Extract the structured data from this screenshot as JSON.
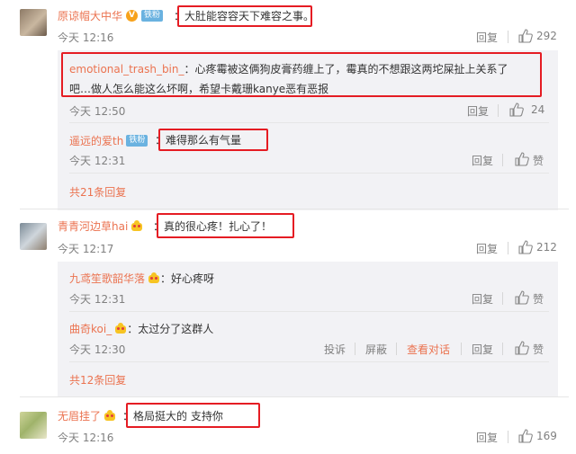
{
  "comments": [
    {
      "username": "原谅帽大中华",
      "badge": "铁粉",
      "sep": "：",
      "text": "大肚能容容天下难容之事。",
      "time": "今天 12:16",
      "reply_label": "回复",
      "likes": "292",
      "replies": [
        {
          "username": "emotional_trash_bin_",
          "sep": "：",
          "text_line1": "心疼霉被这俩狗皮膏药缠上了，霉真的不想跟这两坨屎扯上关系了",
          "text_line2": "吧…做人怎么能这么坏啊，希望卡戴珊kanye恶有恶报",
          "time": "今天 12:50",
          "reply_label": "回复",
          "likes": "24"
        },
        {
          "username": "遥远的爱th",
          "badge": "铁粉",
          "sep": "：",
          "text": "难得那么有气量",
          "time": "今天 12:31",
          "reply_label": "回复",
          "likes": "赞"
        }
      ],
      "more_replies": "共21条回复"
    },
    {
      "username": "青青河边草hai",
      "sep": "：",
      "text": "真的很心疼！扎心了！",
      "time": "今天 12:17",
      "reply_label": "回复",
      "likes": "212",
      "replies": [
        {
          "username": "九鸢笙歌韶华落",
          "sep": "：",
          "text": "好心疼呀",
          "time": "今天 12:31",
          "reply_label": "回复",
          "likes": "赞"
        },
        {
          "username": "曲奇koi_",
          "sep": "：",
          "text": "太过分了这群人",
          "time": "今天 12:30",
          "actions": [
            "投诉",
            "屏蔽",
            "查看对话"
          ],
          "reply_label": "回复",
          "likes": "赞"
        }
      ],
      "more_replies": "共12条回复"
    },
    {
      "username": "无眉挂了",
      "sep": "：",
      "text": "格局挺大的 支持你",
      "time": "今天 12:16",
      "reply_label": "回复",
      "likes": "169"
    }
  ],
  "icons": {
    "verified": "V",
    "crown": "crown-icon",
    "thumb": "thumb-up-icon"
  },
  "colors": {
    "username": "#eb7350",
    "highlight_box": "#e51c23",
    "reply_bg": "#f2f2f5"
  }
}
